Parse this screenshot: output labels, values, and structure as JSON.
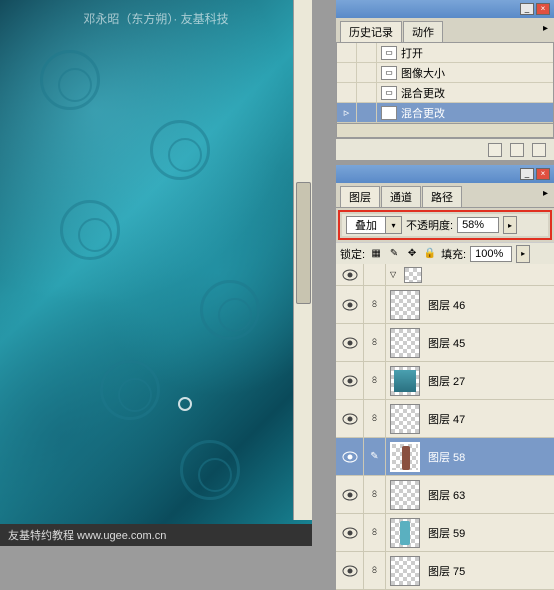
{
  "watermark": "邓永昭（东方朔）· 友基科技",
  "bottom_text": "友基特约教程   www.ugee.com.cn",
  "history_panel": {
    "tabs": {
      "history": "历史记录",
      "actions": "动作"
    },
    "items": [
      {
        "label": "打开"
      },
      {
        "label": "图像大小"
      },
      {
        "label": "混合更改"
      },
      {
        "label": "混合更改"
      }
    ]
  },
  "layers_panel": {
    "tabs": {
      "layers": "图层",
      "channels": "通道",
      "paths": "路径"
    },
    "blend_mode": "叠加",
    "opacity_label": "不透明度:",
    "opacity_value": "58%",
    "lock_label": "锁定:",
    "fill_label": "填充:",
    "fill_value": "100%",
    "layers": [
      {
        "name": "图层 46"
      },
      {
        "name": "图层 45"
      },
      {
        "name": "图层 27"
      },
      {
        "name": "图层 47"
      },
      {
        "name": "图层 58"
      },
      {
        "name": "图层 63"
      },
      {
        "name": "图层 59"
      },
      {
        "name": "图层 75"
      }
    ]
  }
}
